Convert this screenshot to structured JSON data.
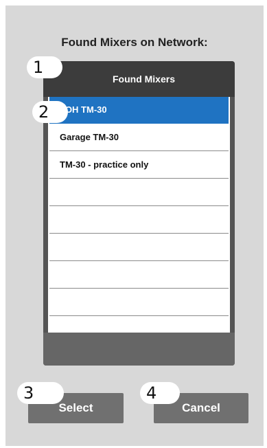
{
  "dialog": {
    "title": "Found Mixers on Network:"
  },
  "list": {
    "header": "Found Mixers",
    "items": [
      {
        "label": "FOH TM-30",
        "selected": true
      },
      {
        "label": "Garage TM-30",
        "selected": false
      },
      {
        "label": "TM-30 - practice only",
        "selected": false
      },
      {
        "label": "",
        "selected": false
      },
      {
        "label": "",
        "selected": false
      },
      {
        "label": "",
        "selected": false
      },
      {
        "label": "",
        "selected": false
      },
      {
        "label": "",
        "selected": false
      }
    ]
  },
  "buttons": {
    "select_label": "Select",
    "cancel_label": "Cancel"
  },
  "callouts": {
    "c1": "1",
    "c2": "2",
    "c3": "3",
    "c4": "4"
  },
  "colors": {
    "selection": "#1f73c2",
    "panel": "#d8d8d8",
    "button": "#707070"
  }
}
